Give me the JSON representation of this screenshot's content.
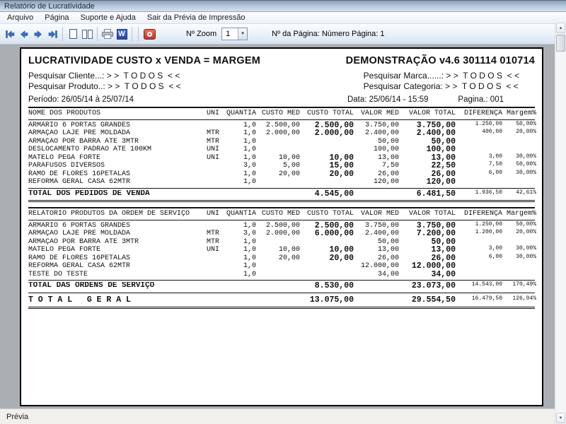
{
  "window": {
    "title": "Relatório de Lucratividade"
  },
  "menu_bar": {
    "items": [
      {
        "label": "Arquivo"
      },
      {
        "label": "Página"
      },
      {
        "label": "Suporte e Ajuda"
      },
      {
        "label": "Sair da Prévia de Impressão"
      }
    ]
  },
  "toolbar": {
    "zoom_label": "Nº Zoom",
    "zoom_value": "1",
    "dropdown_arrow": "▼",
    "page_info": "Nº da Página: Número Página: 1",
    "word_icon_glyph": "W"
  },
  "scrollbar": {
    "up_glyph": "▲",
    "down_glyph": "▼"
  },
  "status_bar": {
    "text": "Prévia"
  },
  "colors": {
    "accent_blue": "#3a6fc0",
    "close_red": "#bd382c",
    "page_border": "#000000"
  },
  "report": {
    "header": {
      "title_left": "LUCRATIVIDADE CUSTO x VENDA = MARGEM",
      "title_right": "DEMONSTRAÇÃO v4.6 301114 010714",
      "filters_left": [
        {
          "label": "Pesquisar Cliente...:",
          "value": " > >  T O D O S  < <"
        },
        {
          "label": "Pesquisar Produto..:",
          "value": " > >  T O D O S  < <"
        }
      ],
      "filters_right": [
        {
          "label": "Pesquisar Marca......:",
          "value": " > >  T O D O S  < <"
        },
        {
          "label": "Pesquisar Categoria:",
          "value": " > >  T O D O S  < <"
        }
      ],
      "period": "Período: 26/05/14 à 25/07/14",
      "date": "Data: 25/06/14 - 15:59",
      "page": "Pagina.: 001"
    },
    "columns": [
      "name",
      "uni",
      "qty",
      "custo_med",
      "custo_total",
      "valor_med",
      "valor_total",
      "diferenca",
      "margem"
    ],
    "tables": [
      {
        "headers": [
          "NOME DOS PRODUTOS",
          "UNI",
          "QUANTIA",
          "CUSTO MED",
          "CUSTO TOTAL",
          "VALOR MED",
          "VALOR TOTAL",
          "DIFERENÇA",
          "Margem%"
        ],
        "rows": [
          {
            "name": "ARMARIO 6 PORTAS GRANDES",
            "uni": "",
            "qty": "1,0",
            "custo_med": "2.500,00",
            "custo_total": "2.500,00",
            "valor_med": "3.750,00",
            "valor_total": "3.750,00",
            "diferenca": "1.250,00",
            "margem": "50,00%"
          },
          {
            "name": "ARMAÇÃO LAJE PRE MOLDADA",
            "uni": "MTR",
            "qty": "1,0",
            "custo_med": "2.000,00",
            "custo_total": "2.000,00",
            "valor_med": "2.400,00",
            "valor_total": "2.400,00",
            "diferenca": "400,00",
            "margem": "20,00%"
          },
          {
            "name": "ARMAÇÃO POR BARRA ATE 3MTR",
            "uni": "MTR",
            "qty": "1,0",
            "custo_med": "",
            "custo_total": "",
            "valor_med": "50,00",
            "valor_total": "50,00",
            "diferenca": "",
            "margem": ""
          },
          {
            "name": "DESLOCAMENTO PADRAO ATE 100KM",
            "uni": "UNI",
            "qty": "1,0",
            "custo_med": "",
            "custo_total": "",
            "valor_med": "100,00",
            "valor_total": "100,00",
            "diferenca": "",
            "margem": ""
          },
          {
            "name": "MATELO PEGA FORTE",
            "uni": "UNI",
            "qty": "1,0",
            "custo_med": "10,00",
            "custo_total": "10,00",
            "valor_med": "13,00",
            "valor_total": "13,00",
            "diferenca": "3,00",
            "margem": "30,00%"
          },
          {
            "name": "PARAFUSOS DIVERSOS",
            "uni": "",
            "qty": "3,0",
            "custo_med": "5,00",
            "custo_total": "15,00",
            "valor_med": "7,50",
            "valor_total": "22,50",
            "diferenca": "7,50",
            "margem": "50,00%"
          },
          {
            "name": "RAMO DE FLORES 16PETALAS",
            "uni": "",
            "qty": "1,0",
            "custo_med": "20,00",
            "custo_total": "20,00",
            "valor_med": "26,00",
            "valor_total": "26,00",
            "diferenca": "6,00",
            "margem": "30,00%"
          },
          {
            "name": "REFORMA GERAL CASA 62MTR",
            "uni": "",
            "qty": "1,0",
            "custo_med": "",
            "custo_total": "",
            "valor_med": "120,00",
            "valor_total": "120,00",
            "diferenca": "",
            "margem": ""
          }
        ],
        "total": {
          "label": "TOTAL DOS PEDIDOS DE VENDA",
          "custo_total": "4.545,00",
          "valor_total": "6.481,50",
          "diferenca": "1.936,50",
          "margem": "42,61%"
        }
      },
      {
        "headers": [
          "RELATÓRIO PRODUTOS DA ORDEM DE SERVIÇO",
          "UNI",
          "QUANTIA",
          "CUSTO MED",
          "CUSTO TOTAL",
          "VALOR MED",
          "VALOR TOTAL",
          "DIFERENÇA",
          "Margem%"
        ],
        "rows": [
          {
            "name": "ARMARIO 6 PORTAS GRANDES",
            "uni": "",
            "qty": "1,0",
            "custo_med": "2.500,00",
            "custo_total": "2.500,00",
            "valor_med": "3.750,00",
            "valor_total": "3.750,00",
            "diferenca": "1.250,00",
            "margem": "50,00%"
          },
          {
            "name": "ARMAÇÃO LAJE PRE MOLDADA",
            "uni": "MTR",
            "qty": "3,0",
            "custo_med": "2.000,00",
            "custo_total": "6.000,00",
            "valor_med": "2.400,00",
            "valor_total": "7.200,00",
            "diferenca": "1.200,00",
            "margem": "20,00%"
          },
          {
            "name": "ARMAÇÃO POR BARRA ATE 3MTR",
            "uni": "MTR",
            "qty": "1,0",
            "custo_med": "",
            "custo_total": "",
            "valor_med": "50,00",
            "valor_total": "50,00",
            "diferenca": "",
            "margem": ""
          },
          {
            "name": "MATELO PEGA FORTE",
            "uni": "UNI",
            "qty": "1,0",
            "custo_med": "10,00",
            "custo_total": "10,00",
            "valor_med": "13,00",
            "valor_total": "13,00",
            "diferenca": "3,00",
            "margem": "30,00%"
          },
          {
            "name": "RAMO DE FLORES 16PETALAS",
            "uni": "",
            "qty": "1,0",
            "custo_med": "20,00",
            "custo_total": "20,00",
            "valor_med": "26,00",
            "valor_total": "26,00",
            "diferenca": "6,00",
            "margem": "30,00%"
          },
          {
            "name": "REFORMA GERAL CASA 62MTR",
            "uni": "",
            "qty": "1,0",
            "custo_med": "",
            "custo_total": "",
            "valor_med": "12.000,00",
            "valor_total": "12.000,00",
            "diferenca": "",
            "margem": ""
          },
          {
            "name": "TESTE DO TESTE",
            "uni": "",
            "qty": "1,0",
            "custo_med": "",
            "custo_total": "",
            "valor_med": "34,00",
            "valor_total": "34,00",
            "diferenca": "",
            "margem": ""
          }
        ],
        "total": {
          "label": "TOTAL DAS ORDENS DE SERVIÇO",
          "custo_total": "8.530,00",
          "valor_total": "23.073,00",
          "diferenca": "14.543,00",
          "margem": "170,49%"
        }
      }
    ],
    "grand_total": {
      "label": "T O T A L   G E R A L",
      "custo_total": "13.075,00",
      "valor_total": "29.554,50",
      "diferenca": "16.479,50",
      "margem": "126,04%"
    }
  }
}
